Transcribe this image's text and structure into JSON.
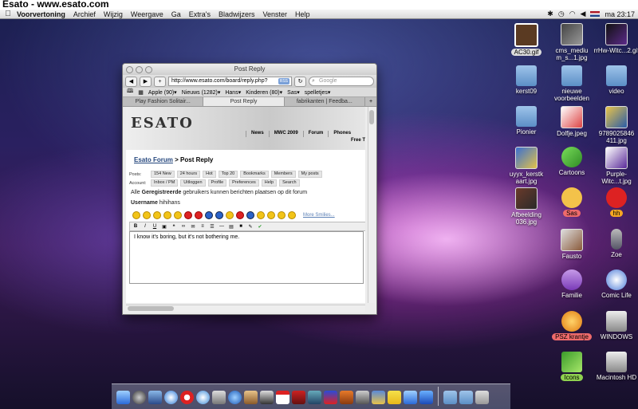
{
  "window_caption": "Esato - www.esato.com",
  "menubar": {
    "app": "Voorvertoning",
    "items": [
      "Archief",
      "Wijzig",
      "Weergave",
      "Ga",
      "Extra's",
      "Bladwijzers",
      "Venster",
      "Help"
    ],
    "clock": "ma 23:17"
  },
  "browser": {
    "title": "Post Reply",
    "url": "http://www.esato.com/board/reply.php?",
    "rss": "RSS",
    "search_placeholder": "Google",
    "bookmarks": [
      "Apple (90)▾",
      "Nieuws (1282)▾",
      "Hans▾",
      "Kinderen (80)▾",
      "Sas▾",
      "spelletjes▾"
    ],
    "tabs": [
      "Play Fashion Solitair...",
      "Post Reply",
      "fabrikanten | Feedba..."
    ],
    "active_tab": 1
  },
  "page": {
    "logo": "ESATO",
    "topnav": [
      "News",
      "MWC 2009",
      "Forum",
      "Phones"
    ],
    "free": "Free T",
    "crumb_link": "Esato Forum",
    "crumb_rest": " > Post Reply",
    "posts_label": "Posts:",
    "posts_items": [
      "154 New",
      "24 hours",
      "Hot",
      "Top 20",
      "Bookmarks",
      "Members",
      "My posts"
    ],
    "account_label": "Account:",
    "account_items": [
      "Inbox / PM",
      "Uitloggen",
      "Profile",
      "Preferences",
      "Help",
      "Search"
    ],
    "notice_pre": "Alle ",
    "notice_bold": "Geregistreerde",
    "notice_post": " gebruikers kunnen berichten plaatsen op dit forum",
    "username_label": "Username",
    "username_value": "hihihans",
    "more_smilies": "More Smilies...",
    "editor_text": "I know it's boring, but it's not bothering me."
  },
  "desktop": [
    {
      "label": "AC30.gif",
      "kind": "thumb"
    },
    {
      "label": "cms_mediu m_s...1.jpg",
      "kind": "thumb"
    },
    {
      "label": "rrHw-Witc...2.gif",
      "kind": "thumb"
    },
    {
      "label": "kerst09",
      "kind": "folder"
    },
    {
      "label": "nieuwe voorbeelden",
      "kind": "folder"
    },
    {
      "label": "video",
      "kind": "folder"
    },
    {
      "label": "Pionier",
      "kind": "folder"
    },
    {
      "label": "Dolfje.jpeg",
      "kind": "thumb"
    },
    {
      "label": "9789025846 411.jpg",
      "kind": "thumb"
    },
    {
      "label": "uyyx_kerstk aart.jpg",
      "kind": "thumb"
    },
    {
      "label": "Cartoons",
      "kind": "thumb"
    },
    {
      "label": "Purple-Witc...t.jpg",
      "kind": "thumb"
    },
    {
      "label": "Afbeelding 036.jpg",
      "kind": "thumb"
    },
    {
      "label": "Sas",
      "kind": "tag"
    },
    {
      "label": "hh",
      "kind": "tag"
    },
    {
      "label": "Fausto",
      "kind": "thumb"
    },
    {
      "label": "Zoe",
      "kind": "thumb"
    },
    {
      "label": "Familie",
      "kind": "thumb"
    },
    {
      "label": "Comic Life",
      "kind": "thumb"
    },
    {
      "label": "PSZ krantje",
      "kind": "tag"
    },
    {
      "label": "WINDOWS",
      "kind": "drive"
    },
    {
      "label": "Icons",
      "kind": "tag"
    },
    {
      "label": "Macintosh HD",
      "kind": "drive"
    }
  ],
  "colors": {
    "tag_red": "#ee6b6b",
    "tag_orange": "#f5a623",
    "tag_green": "#8fd14f"
  }
}
